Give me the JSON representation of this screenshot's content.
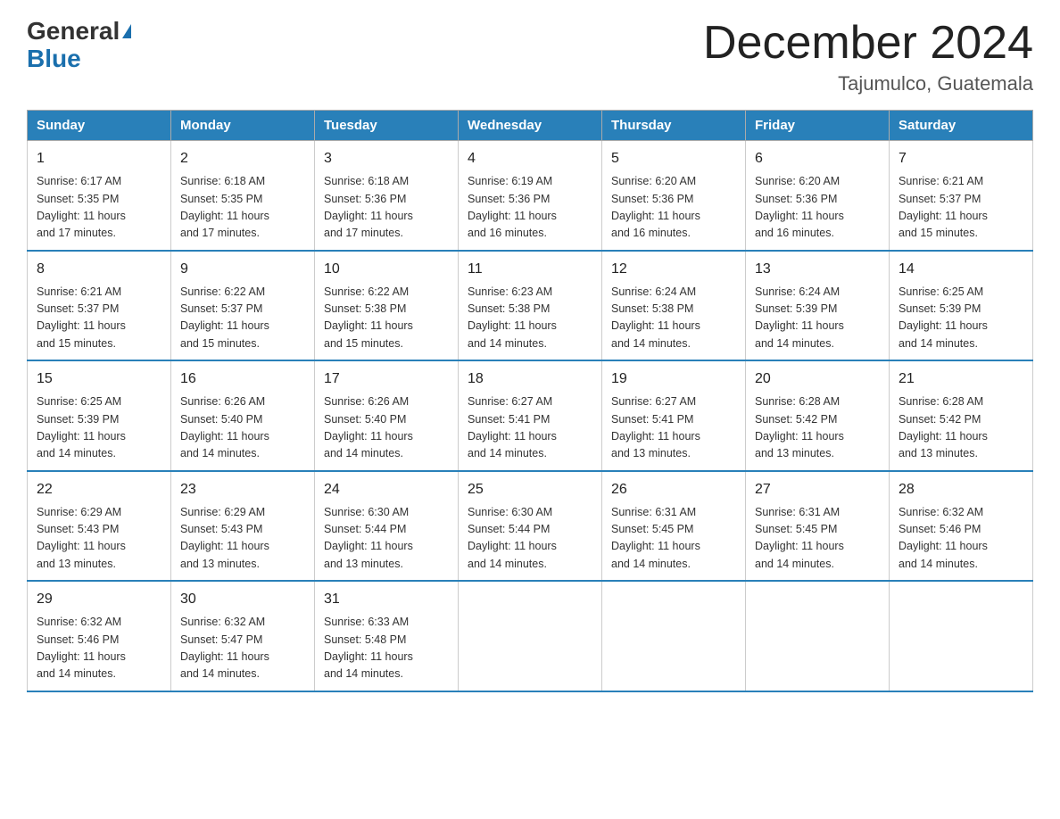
{
  "header": {
    "logo_line1": "General",
    "logo_line2": "Blue",
    "title": "December 2024",
    "subtitle": "Tajumulco, Guatemala"
  },
  "days_of_week": [
    "Sunday",
    "Monday",
    "Tuesday",
    "Wednesday",
    "Thursday",
    "Friday",
    "Saturday"
  ],
  "weeks": [
    [
      {
        "day": "1",
        "sunrise": "6:17 AM",
        "sunset": "5:35 PM",
        "daylight": "11 hours and 17 minutes."
      },
      {
        "day": "2",
        "sunrise": "6:18 AM",
        "sunset": "5:35 PM",
        "daylight": "11 hours and 17 minutes."
      },
      {
        "day": "3",
        "sunrise": "6:18 AM",
        "sunset": "5:36 PM",
        "daylight": "11 hours and 17 minutes."
      },
      {
        "day": "4",
        "sunrise": "6:19 AM",
        "sunset": "5:36 PM",
        "daylight": "11 hours and 16 minutes."
      },
      {
        "day": "5",
        "sunrise": "6:20 AM",
        "sunset": "5:36 PM",
        "daylight": "11 hours and 16 minutes."
      },
      {
        "day": "6",
        "sunrise": "6:20 AM",
        "sunset": "5:36 PM",
        "daylight": "11 hours and 16 minutes."
      },
      {
        "day": "7",
        "sunrise": "6:21 AM",
        "sunset": "5:37 PM",
        "daylight": "11 hours and 15 minutes."
      }
    ],
    [
      {
        "day": "8",
        "sunrise": "6:21 AM",
        "sunset": "5:37 PM",
        "daylight": "11 hours and 15 minutes."
      },
      {
        "day": "9",
        "sunrise": "6:22 AM",
        "sunset": "5:37 PM",
        "daylight": "11 hours and 15 minutes."
      },
      {
        "day": "10",
        "sunrise": "6:22 AM",
        "sunset": "5:38 PM",
        "daylight": "11 hours and 15 minutes."
      },
      {
        "day": "11",
        "sunrise": "6:23 AM",
        "sunset": "5:38 PM",
        "daylight": "11 hours and 14 minutes."
      },
      {
        "day": "12",
        "sunrise": "6:24 AM",
        "sunset": "5:38 PM",
        "daylight": "11 hours and 14 minutes."
      },
      {
        "day": "13",
        "sunrise": "6:24 AM",
        "sunset": "5:39 PM",
        "daylight": "11 hours and 14 minutes."
      },
      {
        "day": "14",
        "sunrise": "6:25 AM",
        "sunset": "5:39 PM",
        "daylight": "11 hours and 14 minutes."
      }
    ],
    [
      {
        "day": "15",
        "sunrise": "6:25 AM",
        "sunset": "5:39 PM",
        "daylight": "11 hours and 14 minutes."
      },
      {
        "day": "16",
        "sunrise": "6:26 AM",
        "sunset": "5:40 PM",
        "daylight": "11 hours and 14 minutes."
      },
      {
        "day": "17",
        "sunrise": "6:26 AM",
        "sunset": "5:40 PM",
        "daylight": "11 hours and 14 minutes."
      },
      {
        "day": "18",
        "sunrise": "6:27 AM",
        "sunset": "5:41 PM",
        "daylight": "11 hours and 14 minutes."
      },
      {
        "day": "19",
        "sunrise": "6:27 AM",
        "sunset": "5:41 PM",
        "daylight": "11 hours and 13 minutes."
      },
      {
        "day": "20",
        "sunrise": "6:28 AM",
        "sunset": "5:42 PM",
        "daylight": "11 hours and 13 minutes."
      },
      {
        "day": "21",
        "sunrise": "6:28 AM",
        "sunset": "5:42 PM",
        "daylight": "11 hours and 13 minutes."
      }
    ],
    [
      {
        "day": "22",
        "sunrise": "6:29 AM",
        "sunset": "5:43 PM",
        "daylight": "11 hours and 13 minutes."
      },
      {
        "day": "23",
        "sunrise": "6:29 AM",
        "sunset": "5:43 PM",
        "daylight": "11 hours and 13 minutes."
      },
      {
        "day": "24",
        "sunrise": "6:30 AM",
        "sunset": "5:44 PM",
        "daylight": "11 hours and 13 minutes."
      },
      {
        "day": "25",
        "sunrise": "6:30 AM",
        "sunset": "5:44 PM",
        "daylight": "11 hours and 14 minutes."
      },
      {
        "day": "26",
        "sunrise": "6:31 AM",
        "sunset": "5:45 PM",
        "daylight": "11 hours and 14 minutes."
      },
      {
        "day": "27",
        "sunrise": "6:31 AM",
        "sunset": "5:45 PM",
        "daylight": "11 hours and 14 minutes."
      },
      {
        "day": "28",
        "sunrise": "6:32 AM",
        "sunset": "5:46 PM",
        "daylight": "11 hours and 14 minutes."
      }
    ],
    [
      {
        "day": "29",
        "sunrise": "6:32 AM",
        "sunset": "5:46 PM",
        "daylight": "11 hours and 14 minutes."
      },
      {
        "day": "30",
        "sunrise": "6:32 AM",
        "sunset": "5:47 PM",
        "daylight": "11 hours and 14 minutes."
      },
      {
        "day": "31",
        "sunrise": "6:33 AM",
        "sunset": "5:48 PM",
        "daylight": "11 hours and 14 minutes."
      },
      null,
      null,
      null,
      null
    ]
  ]
}
